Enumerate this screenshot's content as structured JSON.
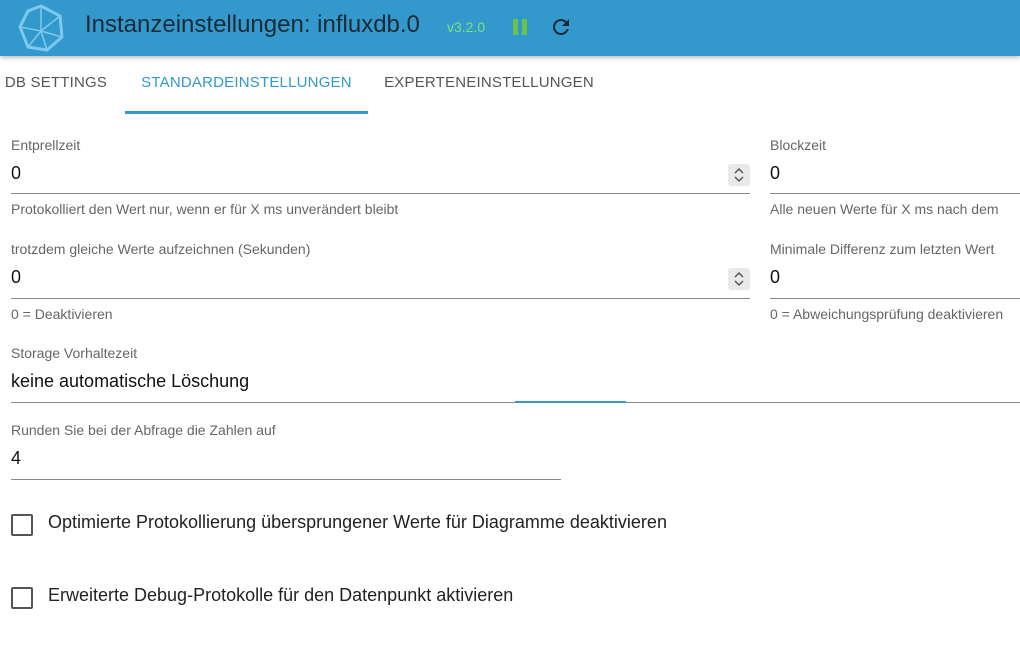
{
  "header": {
    "title": "Instanzeinstellungen: influxdb.0",
    "version": "v3.2.0",
    "logo_icon": "iobroker-logo-icon",
    "pause_icon": "pause-icon",
    "reload_icon": "reload-icon",
    "background_color": "#3399cc",
    "version_color": "#7fe07f"
  },
  "tabs": [
    {
      "label": "DB SETTINGS",
      "active": false
    },
    {
      "label": "STANDARDEINSTELLUNGEN",
      "active": true
    },
    {
      "label": "EXPERTENEINSTELLUNGEN",
      "active": false
    }
  ],
  "form": {
    "debounce": {
      "label": "Entprellzeit",
      "value": "0",
      "help": "Protokolliert den Wert nur, wenn er für X ms unverändert bleibt"
    },
    "blocktime": {
      "label": "Blockzeit",
      "value": "0",
      "help": "Alle neuen Werte für X ms nach dem"
    },
    "changes_relog": {
      "label": "trotzdem gleiche Werte aufzeichnen (Sekunden)",
      "value": "0",
      "help": "0 = Deaktivieren"
    },
    "min_diff": {
      "label": "Minimale Differenz zum letzten Wert",
      "value": "0",
      "help": "0 = Abweichungsprüfung deaktivieren"
    },
    "retention": {
      "label": "Storage Vorhaltezeit",
      "value": "keine automatische Löschung"
    },
    "round": {
      "label": "Runden Sie bei der Abfrage die Zahlen auf",
      "value": "4"
    },
    "checkbox_optimized": {
      "label": "Optimierte Protokollierung übersprungener Werte für Diagramme deaktivieren",
      "checked": false
    },
    "checkbox_debug": {
      "label": "Erweiterte Debug-Protokolle für den Datenpunkt aktivieren",
      "checked": false
    }
  }
}
